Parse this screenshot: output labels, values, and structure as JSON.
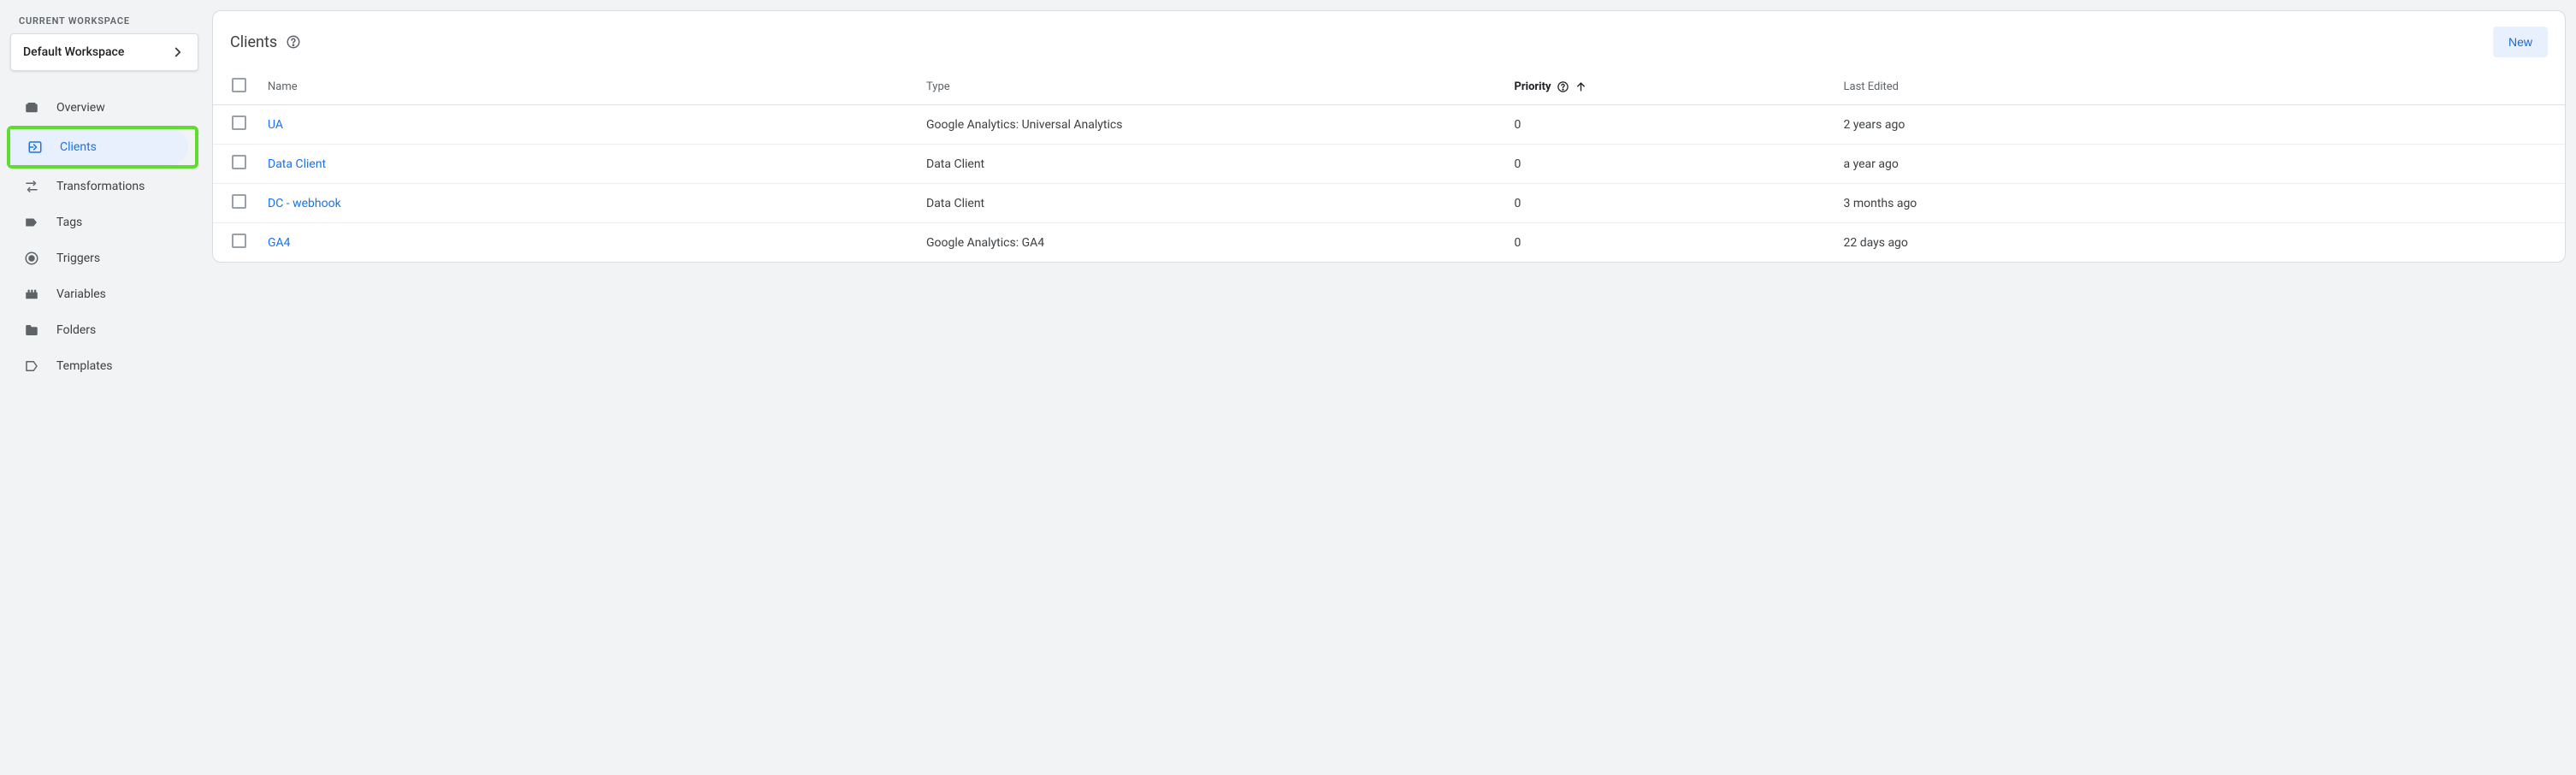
{
  "workspace": {
    "section_label": "CURRENT WORKSPACE",
    "name": "Default Workspace"
  },
  "sidebar": {
    "items": [
      {
        "label": "Overview",
        "icon": "overview"
      },
      {
        "label": "Clients",
        "icon": "clients",
        "selected": true
      },
      {
        "label": "Transformations",
        "icon": "transformations"
      },
      {
        "label": "Tags",
        "icon": "tags"
      },
      {
        "label": "Triggers",
        "icon": "triggers"
      },
      {
        "label": "Variables",
        "icon": "variables"
      },
      {
        "label": "Folders",
        "icon": "folders"
      },
      {
        "label": "Templates",
        "icon": "templates"
      }
    ]
  },
  "header": {
    "title": "Clients",
    "new_button": "New"
  },
  "table": {
    "columns": {
      "name": "Name",
      "type": "Type",
      "priority": "Priority",
      "last_edited": "Last Edited"
    },
    "rows": [
      {
        "name": "UA",
        "type": "Google Analytics: Universal Analytics",
        "priority": "0",
        "last_edited": "2 years ago"
      },
      {
        "name": "Data Client",
        "type": "Data Client",
        "priority": "0",
        "last_edited": "a year ago"
      },
      {
        "name": "DC - webhook",
        "type": "Data Client",
        "priority": "0",
        "last_edited": "3 months ago"
      },
      {
        "name": "GA4",
        "type": "Google Analytics: GA4",
        "priority": "0",
        "last_edited": "22 days ago"
      }
    ]
  }
}
